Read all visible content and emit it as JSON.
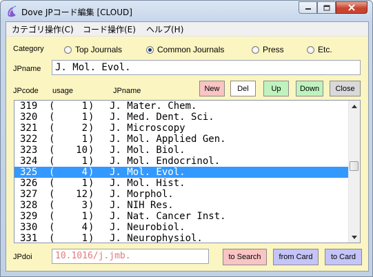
{
  "window": {
    "title": "Dove JPコード編集 [CLOUD]"
  },
  "menu": [
    "カテゴリ操作(C)",
    "コード操作(E)",
    "ヘルプ(H)"
  ],
  "category": {
    "label": "Category",
    "options": [
      {
        "label": "Top Journals",
        "selected": false
      },
      {
        "label": "Common Journals",
        "selected": true
      },
      {
        "label": "Press",
        "selected": false
      },
      {
        "label": "Etc.",
        "selected": false
      }
    ]
  },
  "jpname": {
    "label": "JPname",
    "value": "J. Mol. Evol."
  },
  "headers": {
    "code": "JPcode",
    "usage": "usage",
    "name": "JPname"
  },
  "buttons": {
    "new": {
      "label": "New",
      "color": "#f9c4c4"
    },
    "del": {
      "label": "Del",
      "color": "#ffffff"
    },
    "up": {
      "label": "Up",
      "color": "#bff2bf"
    },
    "down": {
      "label": "Down",
      "color": "#bff2bf"
    },
    "close": {
      "label": "Close",
      "color": "#d9d9d9"
    }
  },
  "list": {
    "selected_code": "325",
    "rows": [
      {
        "code": "319",
        "usage": "1",
        "name": "J. Mater. Chem."
      },
      {
        "code": "320",
        "usage": "1",
        "name": "J. Med. Dent. Sci."
      },
      {
        "code": "321",
        "usage": "2",
        "name": "J. Microscopy"
      },
      {
        "code": "322",
        "usage": "1",
        "name": "J. Mol. Applied Gen."
      },
      {
        "code": "323",
        "usage": "10",
        "name": "J. Mol. Biol."
      },
      {
        "code": "324",
        "usage": "1",
        "name": "J. Mol. Endocrinol."
      },
      {
        "code": "325",
        "usage": "4",
        "name": "J. Mol. Evol."
      },
      {
        "code": "326",
        "usage": "1",
        "name": "J. Mol. Hist."
      },
      {
        "code": "327",
        "usage": "12",
        "name": "J. Morphol."
      },
      {
        "code": "328",
        "usage": "3",
        "name": "J. NIH Res."
      },
      {
        "code": "329",
        "usage": "1",
        "name": "J. Nat. Cancer Inst."
      },
      {
        "code": "330",
        "usage": "4",
        "name": "J. Neurobiol."
      },
      {
        "code": "331",
        "usage": "1",
        "name": "J. Neurophysiol."
      }
    ]
  },
  "jpdoi": {
    "label": "JPdoi",
    "value": "10.1016/j.jmb."
  },
  "bottom_buttons": {
    "to_search": {
      "label": "to Search",
      "color": "#f9c4c4"
    },
    "from_card": {
      "label": "from Card",
      "color": "#c4c4f9"
    },
    "to_card": {
      "label": "to Card",
      "color": "#c4c4f9"
    }
  },
  "icons": {
    "app": "dove-app-icon",
    "up": "scroll-up-icon",
    "down": "scroll-down-icon"
  }
}
